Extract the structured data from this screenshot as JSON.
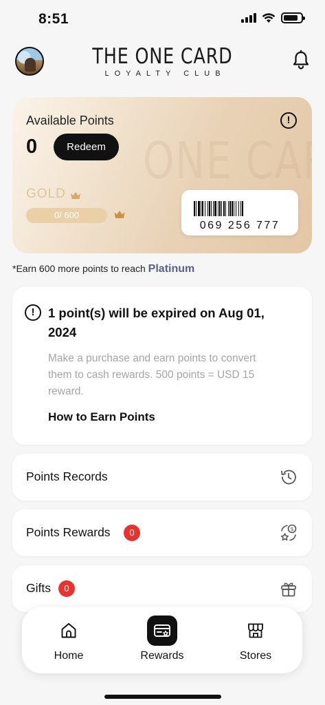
{
  "status_bar": {
    "time": "8:51"
  },
  "header": {
    "brand_title": "THE ONE CARD",
    "brand_subtitle": "LOYALTY CLUB",
    "icons": {
      "avatar": "profile-avatar",
      "notifications": "bell-icon"
    }
  },
  "loyalty_card": {
    "points_label": "Available Points",
    "points_value": "0",
    "redeem_label": "Redeem",
    "watermark": "ONE CARD",
    "tier": "GOLD",
    "progress_text": "0/ 600",
    "progress_fraction": 0,
    "barcode_number": "069 256 777",
    "colors": {
      "card_start": "#fbf4ea",
      "card_end": "#e3c7a5",
      "progress_track": "#ebcfa7"
    }
  },
  "earn_note": {
    "text": "*Earn 600 more points to reach ",
    "next_tier": "Platinum",
    "tier_color": "#5a5f91"
  },
  "expiry": {
    "title": "1 point(s) will be expired on Aug 01, 2024",
    "description": "Make a purchase and earn points to convert them to cash rewards. 500 points = USD 15 reward.",
    "link_label": "How to Earn Points"
  },
  "menu_rows": [
    {
      "label": "Points Records",
      "icon": "history-icon"
    },
    {
      "label": "Points Rewards",
      "badge": "0",
      "icon": "rewards-exchange-icon"
    },
    {
      "label": "Gifts",
      "badge": "0",
      "icon": "gift-icon"
    }
  ],
  "bottom_nav": {
    "items": [
      {
        "label": "Home",
        "icon": "home-icon",
        "active": false
      },
      {
        "label": "Rewards",
        "icon": "rewards-card-icon",
        "active": true
      },
      {
        "label": "Stores",
        "icon": "store-icon",
        "active": false
      }
    ],
    "active_color": "#111111"
  },
  "badge_color": "#e8322f"
}
